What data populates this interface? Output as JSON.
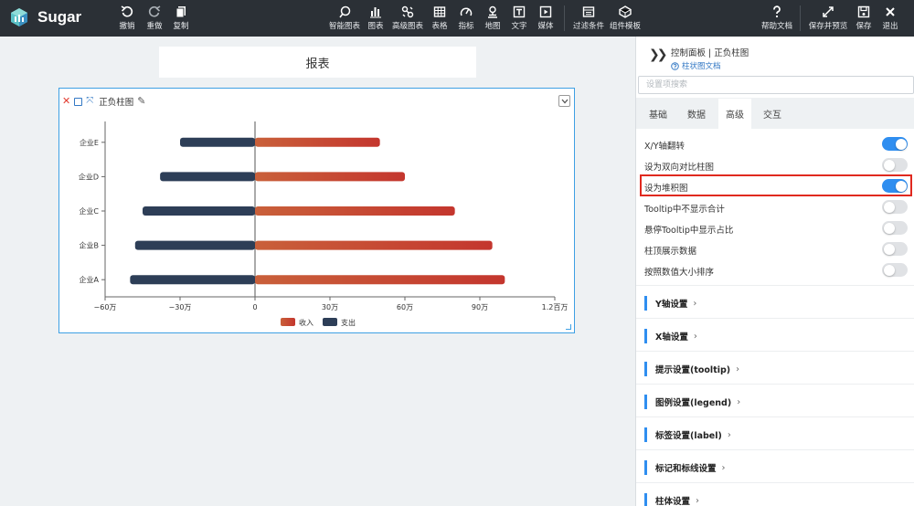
{
  "app": {
    "name": "Sugar"
  },
  "toolbar": {
    "left": [
      {
        "label": "撤销",
        "icon": "undo-icon"
      },
      {
        "label": "重做",
        "icon": "redo-icon"
      },
      {
        "label": "复制",
        "icon": "copy-icon"
      }
    ],
    "center": [
      {
        "label": "智能图表",
        "icon": "smart-chart-icon"
      },
      {
        "label": "图表",
        "icon": "bar-chart-icon"
      },
      {
        "label": "高级图表",
        "icon": "advanced-chart-icon"
      },
      {
        "label": "表格",
        "icon": "table-icon"
      },
      {
        "label": "指标",
        "icon": "gauge-icon"
      },
      {
        "label": "地图",
        "icon": "map-pin-icon"
      },
      {
        "label": "文字",
        "icon": "text-icon"
      },
      {
        "label": "媒体",
        "icon": "media-play-icon"
      },
      {
        "label": "过滤条件",
        "icon": "filter-icon"
      },
      {
        "label": "组件模板",
        "icon": "template-icon"
      }
    ],
    "right": [
      {
        "label": "帮助文档",
        "icon": "help-icon"
      },
      {
        "label": "保存并预览",
        "icon": "save-preview-icon"
      },
      {
        "label": "保存",
        "icon": "save-icon"
      },
      {
        "label": "退出",
        "icon": "exit-icon"
      }
    ]
  },
  "canvas": {
    "report_title": "报表",
    "widget": {
      "name": "正负柱图"
    }
  },
  "chart_data": {
    "type": "bar",
    "orientation": "horizontal",
    "stacked": true,
    "categories": [
      "企业A",
      "企业B",
      "企业C",
      "企业D",
      "企业E"
    ],
    "series": [
      {
        "name": "收入",
        "values": [
          1000000,
          950000,
          800000,
          600000,
          500000
        ],
        "color": "#c8472f"
      },
      {
        "name": "支出",
        "values": [
          -500000,
          -480000,
          -450000,
          -380000,
          -300000
        ],
        "color": "#2d3e57"
      }
    ],
    "x_ticks": [
      {
        "value": -600000,
        "label": "−60万"
      },
      {
        "value": -300000,
        "label": "−30万"
      },
      {
        "value": 0,
        "label": "0"
      },
      {
        "value": 300000,
        "label": "30万"
      },
      {
        "value": 600000,
        "label": "60万"
      },
      {
        "value": 900000,
        "label": "90万"
      },
      {
        "value": 1200000,
        "label": "1.2百万"
      }
    ],
    "xlim": [
      -600000,
      1200000
    ],
    "grid": false,
    "legend_position": "bottom"
  },
  "panel": {
    "title": "控制面板 | 正负柱图",
    "doc_link": "柱状图文档",
    "search_placeholder": "设置项搜索",
    "tabs": [
      {
        "label": "基础",
        "active": false
      },
      {
        "label": "数据",
        "active": false
      },
      {
        "label": "高级",
        "active": true
      },
      {
        "label": "交互",
        "active": false
      }
    ],
    "options": [
      {
        "label": "X/Y轴翻转",
        "on": true
      },
      {
        "label": "设为双向对比柱图",
        "on": false
      },
      {
        "label": "设为堆积图",
        "on": true
      },
      {
        "label": "Tooltip中不显示合计",
        "on": false
      },
      {
        "label": "悬停Tooltip中显示占比",
        "on": false
      },
      {
        "label": "柱顶展示数据",
        "on": false
      },
      {
        "label": "按照数值大小排序",
        "on": false
      }
    ],
    "sections": [
      "Y轴设置",
      "X轴设置",
      "提示设置(tooltip)",
      "图例设置(legend)",
      "标签设置(label)",
      "标记和标线设置",
      "柱体设置"
    ]
  }
}
